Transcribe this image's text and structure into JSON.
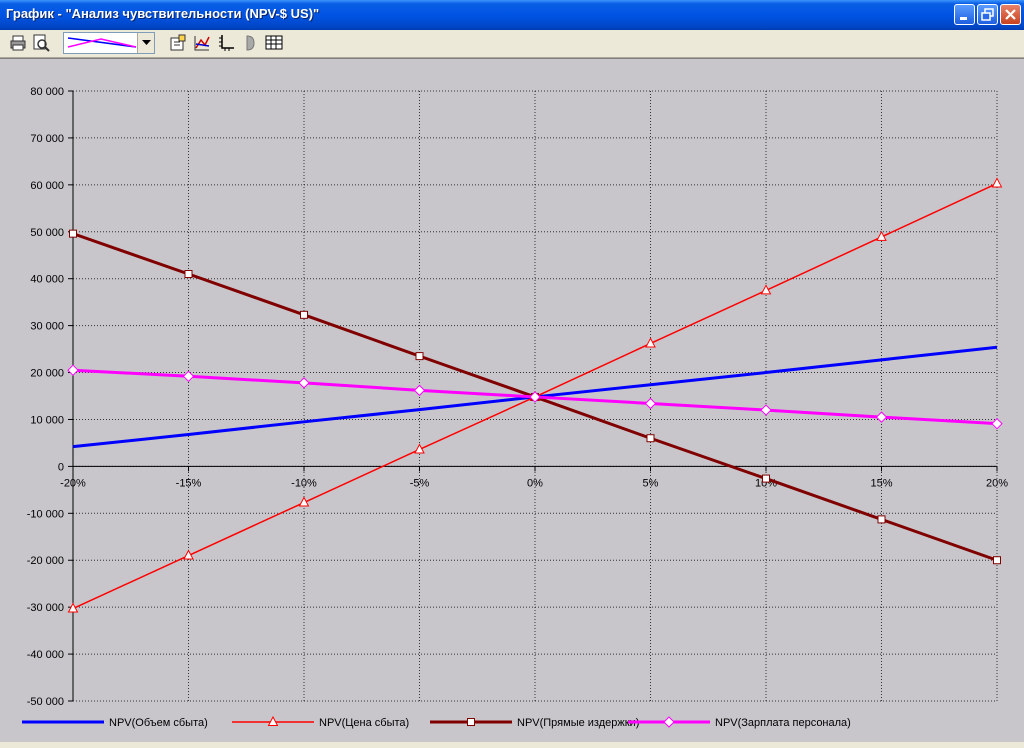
{
  "window": {
    "title": "График - \"Анализ чувствительности (NPV-$ US)\"",
    "buttons": [
      "minimize",
      "maximize",
      "close"
    ]
  },
  "toolbar": {
    "items": [
      "print-icon",
      "print-preview-icon",
      "chart-type-dropdown",
      "properties-icon",
      "series-icon",
      "axes-icon",
      "legend-icon",
      "table-icon"
    ]
  },
  "chart_data": {
    "type": "line",
    "title": "",
    "xlabel": "",
    "ylabel": "",
    "x": [
      "-20%",
      "-15%",
      "-10%",
      "-5%",
      "0%",
      "5%",
      "10%",
      "15%",
      "20%"
    ],
    "x_values": [
      -20,
      -15,
      -10,
      -5,
      0,
      5,
      10,
      15,
      20
    ],
    "xlim": [
      -20,
      20
    ],
    "ylim": [
      -50000,
      80000
    ],
    "yticks": [
      80000,
      70000,
      60000,
      50000,
      40000,
      30000,
      20000,
      10000,
      0,
      -10000,
      -20000,
      -30000,
      -40000,
      -50000
    ],
    "ytick_labels": [
      "80 000",
      "70 000",
      "60 000",
      "50 000",
      "40 000",
      "30 000",
      "20 000",
      "10 000",
      "0",
      "-10 000",
      "-20 000",
      "-30 000",
      "-40 000",
      "-50 000"
    ],
    "grid": true,
    "legend_position": "bottom",
    "series": [
      {
        "name": "NPV(Объем сбыта)",
        "color": "#0000ff",
        "marker": "none",
        "width": 3,
        "values": [
          4200,
          6800,
          9500,
          12100,
          14800,
          17400,
          20000,
          22700,
          25400
        ]
      },
      {
        "name": "NPV(Цена сбыта)",
        "color": "#ff0000",
        "marker": "triangle",
        "width": 1.5,
        "values": [
          -30300,
          -19000,
          -7700,
          3600,
          14800,
          26200,
          37500,
          48900,
          60300
        ]
      },
      {
        "name": "NPV(Прямые издержки)",
        "color": "#800000",
        "marker": "square",
        "width": 3,
        "values": [
          49600,
          41000,
          32300,
          23500,
          14800,
          6000,
          -2600,
          -11300,
          -20000
        ]
      },
      {
        "name": "NPV(Зарплата персонала)",
        "color": "#ff00ff",
        "marker": "diamond",
        "width": 3,
        "values": [
          20500,
          19200,
          17800,
          16200,
          14800,
          13400,
          12000,
          10500,
          9100
        ]
      }
    ]
  }
}
